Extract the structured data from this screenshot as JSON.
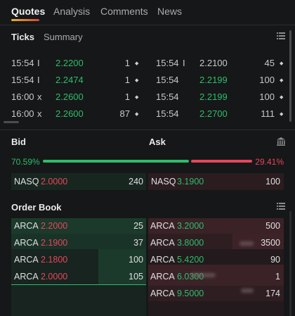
{
  "tabs": [
    {
      "label": "Quotes",
      "active": true
    },
    {
      "label": "Analysis",
      "active": false
    },
    {
      "label": "Comments",
      "active": false
    },
    {
      "label": "News",
      "active": false
    }
  ],
  "ticks": {
    "title": "Ticks",
    "summary_tab": "Summary",
    "left": [
      {
        "time": "15:54",
        "flag": "I",
        "price": "2.2200",
        "size": "1"
      },
      {
        "time": "15:54",
        "flag": "I",
        "price": "2.2474",
        "size": "1"
      },
      {
        "time": "16:00",
        "flag": "x",
        "price": "2.2600",
        "size": "1"
      },
      {
        "time": "16:00",
        "flag": "x",
        "price": "2.2600",
        "size": "87"
      }
    ],
    "right": [
      {
        "time": "15:54",
        "flag": "I",
        "price": "2.2100",
        "size": "45"
      },
      {
        "time": "15:54",
        "flag": "",
        "price": "2.2199",
        "size": "100"
      },
      {
        "time": "15:54",
        "flag": "",
        "price": "2.2199",
        "size": "100"
      },
      {
        "time": "15:54",
        "flag": "",
        "price": "2.2700",
        "size": "111"
      }
    ]
  },
  "bidask": {
    "bid_label": "Bid",
    "ask_label": "Ask",
    "bid_pct": "70.59%",
    "ask_pct": "29.41%",
    "bid_fraction": 0.7059,
    "bid": {
      "exchange": "NASQ",
      "price": "2.0000",
      "size": "240"
    },
    "ask": {
      "exchange": "NASQ",
      "price": "3.1900",
      "size": "100"
    }
  },
  "orderbook": {
    "title": "Order Book",
    "bids": [
      {
        "exchange": "ARCA",
        "price": "2.2000",
        "size": "25"
      },
      {
        "exchange": "ARCA",
        "price": "2.1900",
        "size": "37"
      },
      {
        "exchange": "ARCA",
        "price": "2.1800",
        "size": "100"
      },
      {
        "exchange": "ARCA",
        "price": "2.0000",
        "size": "105"
      }
    ],
    "asks": [
      {
        "exchange": "ARCA",
        "price": "3.2000",
        "size": "500"
      },
      {
        "exchange": "ARCA",
        "price": "3.8000",
        "size": "3500"
      },
      {
        "exchange": "ARCA",
        "price": "5.4200",
        "size": "90"
      },
      {
        "exchange": "ARCA",
        "price": "6.0300",
        "size": "1"
      },
      {
        "exchange": "ARCA",
        "price": "9.5000",
        "size": "174"
      }
    ]
  },
  "colors": {
    "bid": "#2dbd6b",
    "ask": "#e8455a",
    "background": "#161718"
  }
}
